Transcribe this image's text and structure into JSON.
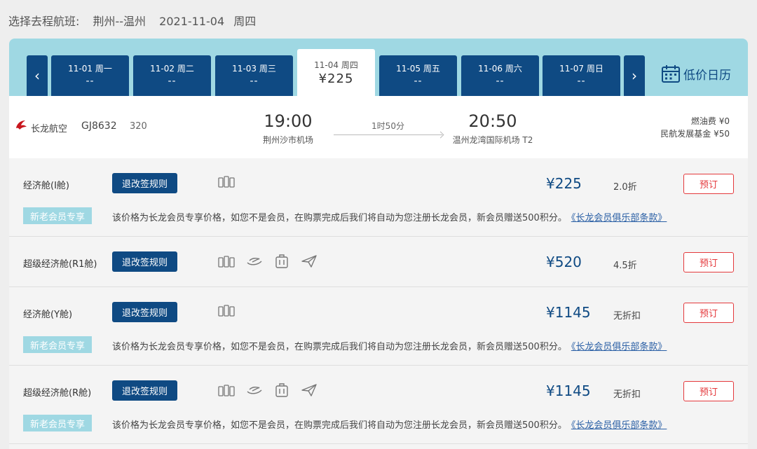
{
  "header": {
    "prefix": "选择去程航班:",
    "route": "荆州--温州",
    "date": "2021-11-04",
    "weekday": "周四"
  },
  "date_tabs": [
    {
      "date": "11-01 周一",
      "price": "--"
    },
    {
      "date": "11-02 周二",
      "price": "--"
    },
    {
      "date": "11-03 周三",
      "price": "--"
    },
    {
      "date": "11-04 周四",
      "price": "¥225",
      "active": true
    },
    {
      "date": "11-05 周五",
      "price": "--"
    },
    {
      "date": "11-06 周六",
      "price": "--"
    },
    {
      "date": "11-07 周日",
      "price": "--"
    }
  ],
  "nav": {
    "prev": "‹",
    "next": "›"
  },
  "low_price_calendar": "低价日历",
  "flight": {
    "airline": "长龙航空",
    "flight_no": "GJ8632",
    "aircraft": "320",
    "dep_time": "19:00",
    "dep_airport": "荆州沙市机场",
    "duration": "1时50分",
    "arr_time": "20:50",
    "arr_airport": "温州龙湾国际机场 T2",
    "fuel_fee": "燃油费 ¥0",
    "airport_fee": "民航发展基金 ¥50"
  },
  "cabins": [
    {
      "name": "经济舱(I舱)",
      "rules": "退改签规则",
      "price": "¥225",
      "discount": "2.0折",
      "book": "预订",
      "member_badge": "新老会员专享",
      "member_text": "该价格为长龙会员专享价格，如您不是会员，在购票完成后我们将自动为您注册长龙会员，新会员赠送500积分。",
      "member_link": "《长龙会员俱乐部条款》"
    },
    {
      "name": "超级经济舱(R1舱)",
      "rules": "退改签规则",
      "price": "¥520",
      "discount": "4.5折",
      "book": "预订"
    },
    {
      "name": "经济舱(Y舱)",
      "rules": "退改签规则",
      "price": "¥1145",
      "discount": "无折扣",
      "book": "预订",
      "member_badge": "新老会员专享",
      "member_text": "该价格为长龙会员专享价格，如您不是会员，在购票完成后我们将自动为您注册长龙会员，新会员赠送500积分。",
      "member_link": "《长龙会员俱乐部条款》"
    },
    {
      "name": "超级经济舱(R舱)",
      "rules": "退改签规则",
      "price": "¥1145",
      "discount": "无折扣",
      "book": "预订",
      "member_badge": "新老会员专享",
      "member_text": "该价格为长龙会员专享价格，如您不是会员，在购票完成后我们将自动为您注册长龙会员，新会员赠送500积分。",
      "member_link": "《长龙会员俱乐部条款》"
    }
  ],
  "colors": {
    "navy": "#0f4a83",
    "band": "#9fd8e3",
    "red": "#e4393c"
  },
  "icons": [
    "luggage-icon",
    "meal-icon",
    "carry-on-icon",
    "paper-plane-icon",
    "calendar-icon",
    "airline-logo-icon"
  ]
}
